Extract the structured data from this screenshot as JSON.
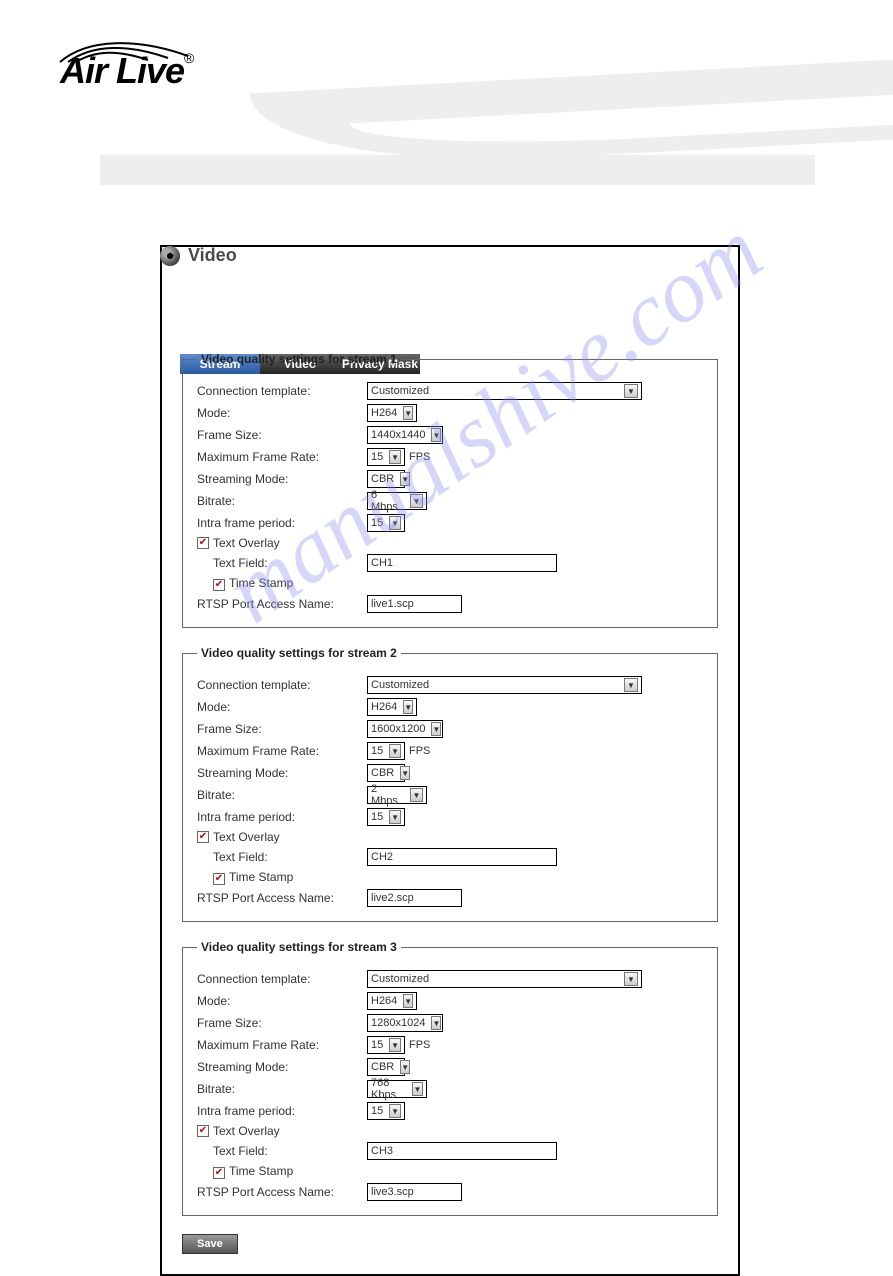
{
  "brand": "Air Live",
  "watermark": "manualshive.com",
  "page": {
    "title": "Video"
  },
  "tabs": {
    "stream": "Stream",
    "video": "Video",
    "privacy": "Privacy Mask"
  },
  "labels": {
    "conn_tpl": "Connection template:",
    "mode": "Mode:",
    "frame_size": "Frame Size:",
    "max_fr": "Maximum Frame Rate:",
    "fps": "FPS",
    "streaming_mode": "Streaming Mode:",
    "bitrate": "Bitrate:",
    "intra": "Intra frame period:",
    "text_overlay": "Text Overlay",
    "text_field": "Text Field:",
    "time_stamp": "Time Stamp",
    "rtsp": "RTSP Port Access Name:"
  },
  "streams": [
    {
      "legend": "Video quality settings for stream 1",
      "conn_tpl": "Customized",
      "mode": "H264",
      "frame_size": "1440x1440",
      "max_fr": "15",
      "streaming_mode": "CBR",
      "bitrate": "6 Mbps",
      "intra": "15",
      "text_overlay": true,
      "text_field": "CH1",
      "time_stamp": true,
      "rtsp": "live1.scp"
    },
    {
      "legend": "Video quality settings for stream 2",
      "conn_tpl": "Customized",
      "mode": "H264",
      "frame_size": "1600x1200",
      "max_fr": "15",
      "streaming_mode": "CBR",
      "bitrate": "2 Mbps",
      "intra": "15",
      "text_overlay": true,
      "text_field": "CH2",
      "time_stamp": true,
      "rtsp": "live2.scp"
    },
    {
      "legend": "Video quality settings for stream 3",
      "conn_tpl": "Customized",
      "mode": "H264",
      "frame_size": "1280x1024",
      "max_fr": "15",
      "streaming_mode": "CBR",
      "bitrate": "768 Kbps",
      "intra": "15",
      "text_overlay": true,
      "text_field": "CH3",
      "time_stamp": true,
      "rtsp": "live3.scp"
    }
  ],
  "save": "Save"
}
